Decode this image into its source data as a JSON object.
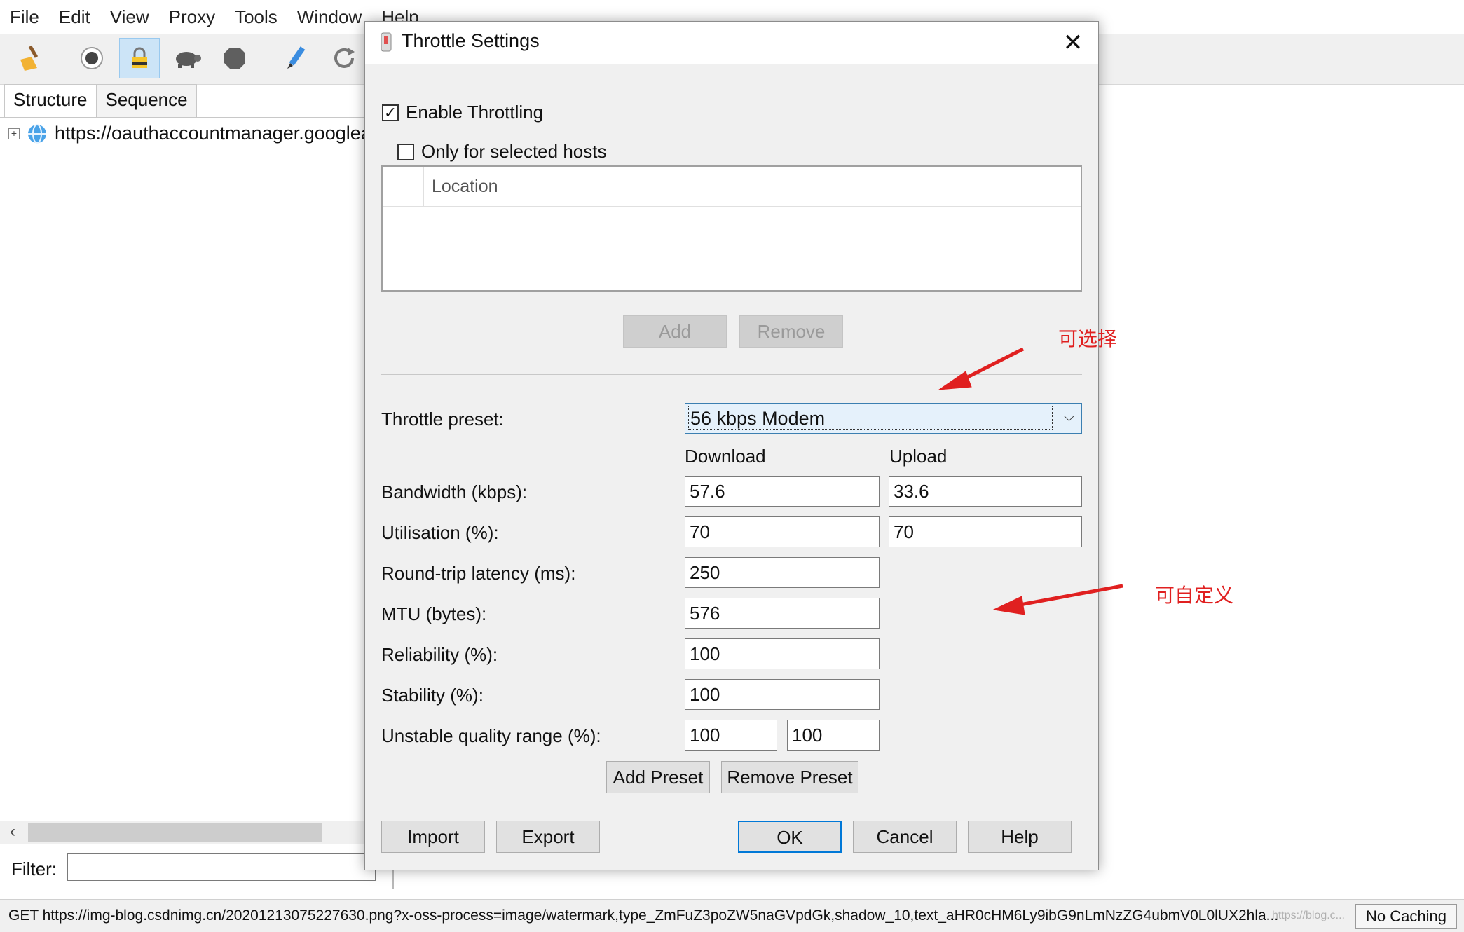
{
  "menu": [
    "File",
    "Edit",
    "View",
    "Proxy",
    "Tools",
    "Window",
    "Help"
  ],
  "toolbar": {
    "icons": [
      "broom-icon",
      "record-icon",
      "ssl-lock-icon",
      "turtle-icon",
      "stop-icon",
      "pen-icon",
      "refresh-icon"
    ]
  },
  "left_pane": {
    "tabs": [
      "Structure",
      "Sequence"
    ],
    "tree_item": "https://oauthaccountmanager.googlea",
    "filter_label": "Filter:",
    "filter_value": ""
  },
  "status": {
    "text": "GET https://img-blog.csdnimg.cn/20201213075227630.png?x-oss-process=image/watermark,type_ZmFuZ3poZW5naGVpdGk,shadow_10,text_aHR0cHM6Ly9ibG9nLmNzZG4ubmV0L0lUX2hla...",
    "watermark": "https://blog.c...",
    "no_caching": "No Caching"
  },
  "dialog": {
    "title": "Throttle Settings",
    "close": "✕",
    "enable_throttling": {
      "label": "Enable Throttling",
      "checked": "✓"
    },
    "only_selected_hosts": {
      "label": "Only for selected hosts",
      "checked": ""
    },
    "hosts_column": "Location",
    "add": "Add",
    "remove": "Remove",
    "preset_label": "Throttle preset:",
    "preset_value": "56 kbps Modem",
    "download_header": "Download",
    "upload_header": "Upload",
    "bandwidth_label": "Bandwidth (kbps):",
    "bandwidth_download": "57.6",
    "bandwidth_upload": "33.6",
    "utilisation_label": "Utilisation (%):",
    "utilisation_download": "70",
    "utilisation_upload": "70",
    "latency_label": "Round-trip latency (ms):",
    "latency": "250",
    "mtu_label": "MTU (bytes):",
    "mtu": "576",
    "reliability_label": "Reliability (%):",
    "reliability": "100",
    "stability_label": "Stability (%):",
    "stability": "100",
    "unstable_label": "Unstable quality range (%):",
    "unstable_min": "100",
    "unstable_max": "100",
    "add_preset": "Add Preset",
    "remove_preset": "Remove Preset",
    "import": "Import",
    "export": "Export",
    "ok": "OK",
    "cancel": "Cancel",
    "help": "Help"
  },
  "annotations": {
    "selectable": "可选择",
    "customizable": "可自定义",
    "color": "#e02020"
  }
}
